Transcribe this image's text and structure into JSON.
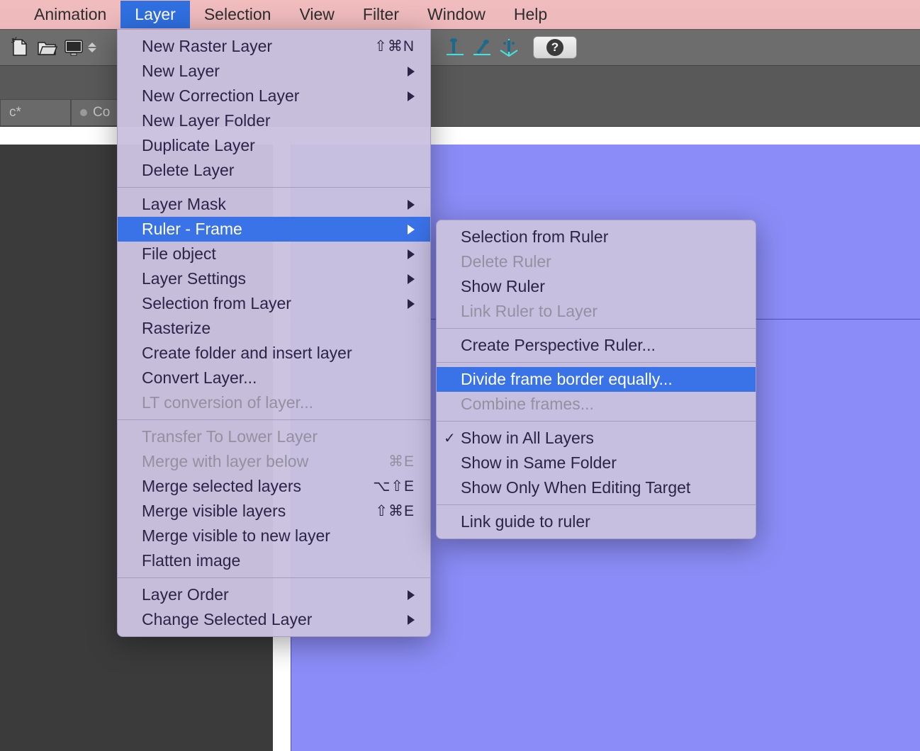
{
  "menubar": {
    "items": [
      "Animation",
      "Layer",
      "Selection",
      "View",
      "Filter",
      "Window",
      "Help"
    ],
    "active_index": 1
  },
  "tabs": {
    "t0": "c*",
    "t1": "Co"
  },
  "layer_menu": {
    "g0": [
      {
        "label": "New Raster Layer",
        "shortcut": "⇧⌘N"
      },
      {
        "label": "New Layer",
        "submenu": true
      },
      {
        "label": "New Correction Layer",
        "submenu": true
      },
      {
        "label": "New Layer Folder"
      },
      {
        "label": "Duplicate Layer"
      },
      {
        "label": "Delete Layer"
      }
    ],
    "g1": [
      {
        "label": "Layer Mask",
        "submenu": true
      },
      {
        "label": "Ruler - Frame",
        "submenu": true,
        "selected": true
      },
      {
        "label": "File object",
        "submenu": true
      },
      {
        "label": "Layer Settings",
        "submenu": true
      },
      {
        "label": "Selection from Layer",
        "submenu": true
      },
      {
        "label": "Rasterize"
      },
      {
        "label": "Create folder and insert layer"
      },
      {
        "label": "Convert Layer..."
      },
      {
        "label": "LT conversion of layer...",
        "disabled": true
      }
    ],
    "g2": [
      {
        "label": "Transfer To Lower Layer",
        "disabled": true
      },
      {
        "label": "Merge with layer below",
        "shortcut": "⌘E",
        "disabled": true
      },
      {
        "label": "Merge selected layers",
        "shortcut": "⌥⇧E"
      },
      {
        "label": "Merge visible layers",
        "shortcut": "⇧⌘E"
      },
      {
        "label": "Merge visible to new layer"
      },
      {
        "label": "Flatten image"
      }
    ],
    "g3": [
      {
        "label": "Layer Order",
        "submenu": true
      },
      {
        "label": "Change Selected Layer",
        "submenu": true
      }
    ]
  },
  "ruler_submenu": {
    "g0": [
      {
        "label": "Selection from Ruler"
      },
      {
        "label": "Delete Ruler",
        "disabled": true
      },
      {
        "label": "Show Ruler"
      },
      {
        "label": "Link Ruler to Layer",
        "disabled": true
      }
    ],
    "g1": [
      {
        "label": "Create Perspective Ruler..."
      }
    ],
    "g2": [
      {
        "label": "Divide frame border equally...",
        "selected": true
      },
      {
        "label": "Combine frames...",
        "disabled": true
      }
    ],
    "g3": [
      {
        "label": "Show in All Layers",
        "checked": true
      },
      {
        "label": "Show in Same Folder"
      },
      {
        "label": "Show Only When Editing Target"
      }
    ],
    "g4": [
      {
        "label": "Link guide to ruler"
      }
    ]
  }
}
